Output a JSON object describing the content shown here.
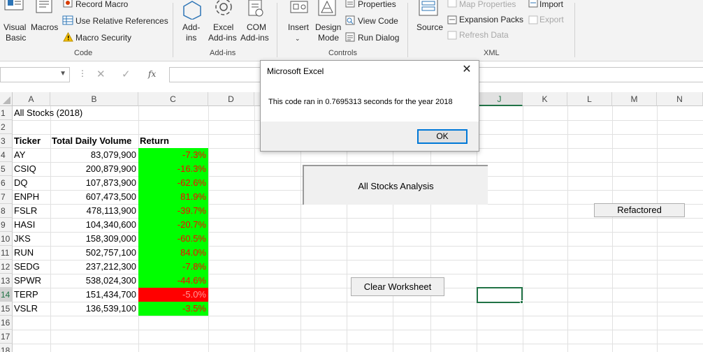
{
  "ribbon": {
    "code_group": {
      "label": "Code",
      "visual_basic": [
        "Visual",
        "Basic"
      ],
      "macros": "Macros",
      "record_macro": "Record Macro",
      "use_relative": "Use Relative References",
      "macro_security": "Macro Security"
    },
    "addins_group": {
      "label": "Add-ins",
      "addins": [
        "Add-",
        "ins"
      ],
      "excel_addins": [
        "Excel",
        "Add-ins"
      ],
      "com_addins": [
        "COM",
        "Add-ins"
      ]
    },
    "controls_group": {
      "label": "Controls",
      "insert": "Insert",
      "design_mode": [
        "Design",
        "Mode"
      ],
      "properties": "Properties",
      "view_code": "View Code",
      "run_dialog": "Run Dialog"
    },
    "xml_group": {
      "label": "XML",
      "source": "Source",
      "map_properties": "Map Properties",
      "expansion_packs": "Expansion Packs",
      "refresh_data": "Refresh Data",
      "import": "Import",
      "export": "Export"
    }
  },
  "formula_bar": {
    "name_box": "",
    "fx": "fx",
    "formula": ""
  },
  "grid": {
    "columns": [
      "A",
      "B",
      "C",
      "D",
      "E",
      "F",
      "G",
      "H",
      "I",
      "J",
      "K",
      "L",
      "M",
      "N"
    ],
    "row_numbers": [
      "1",
      "2",
      "3",
      "4",
      "5",
      "6",
      "7",
      "8",
      "9",
      "10",
      "11",
      "12",
      "13",
      "14",
      "15",
      "16",
      "17",
      "18"
    ],
    "title": "All Stocks (2018)",
    "headers": [
      "Ticker",
      "Total Daily Volume",
      "Return"
    ],
    "rows": [
      {
        "ticker": "AY",
        "volume": "83,079,900",
        "ret": "-7.3%",
        "color": "#00ff00"
      },
      {
        "ticker": "CSIQ",
        "volume": "200,879,900",
        "ret": "-16.3%",
        "color": "#00ff00"
      },
      {
        "ticker": "DQ",
        "volume": "107,873,900",
        "ret": "-62.6%",
        "color": "#00ff00"
      },
      {
        "ticker": "ENPH",
        "volume": "607,473,500",
        "ret": "81.9%",
        "color": "#00ff00"
      },
      {
        "ticker": "FSLR",
        "volume": "478,113,900",
        "ret": "-39.7%",
        "color": "#00ff00"
      },
      {
        "ticker": "HASI",
        "volume": "104,340,600",
        "ret": "-20.7%",
        "color": "#00ff00"
      },
      {
        "ticker": "JKS",
        "volume": "158,309,000",
        "ret": "-60.5%",
        "color": "#00ff00"
      },
      {
        "ticker": "RUN",
        "volume": "502,757,100",
        "ret": "84.0%",
        "color": "#00ff00"
      },
      {
        "ticker": "SEDG",
        "volume": "237,212,300",
        "ret": "-7.8%",
        "color": "#00ff00"
      },
      {
        "ticker": "SPWR",
        "volume": "538,024,300",
        "ret": "-44.6%",
        "color": "#00ff00"
      },
      {
        "ticker": "TERP",
        "volume": "151,434,700",
        "ret": "-5.0%",
        "color": "#ff0000"
      },
      {
        "ticker": "VSLR",
        "volume": "136,539,100",
        "ret": "-3.5%",
        "color": "#00ff00"
      }
    ]
  },
  "sheet_buttons": {
    "all_stocks": "All Stocks Analysis",
    "refactored": "Refactored",
    "clear": "Clear Worksheet"
  },
  "dialog": {
    "title": "Microsoft Excel",
    "close": "✕",
    "message": "This code ran in 0.7695313 seconds for the year 2018",
    "ok": "OK"
  },
  "colors": {
    "excel_green": "#217346",
    "positive_fill": "#00ff00",
    "negative_fill": "#ff0000",
    "return_text": "#ff0000",
    "ok_focus": "#0078d7"
  }
}
